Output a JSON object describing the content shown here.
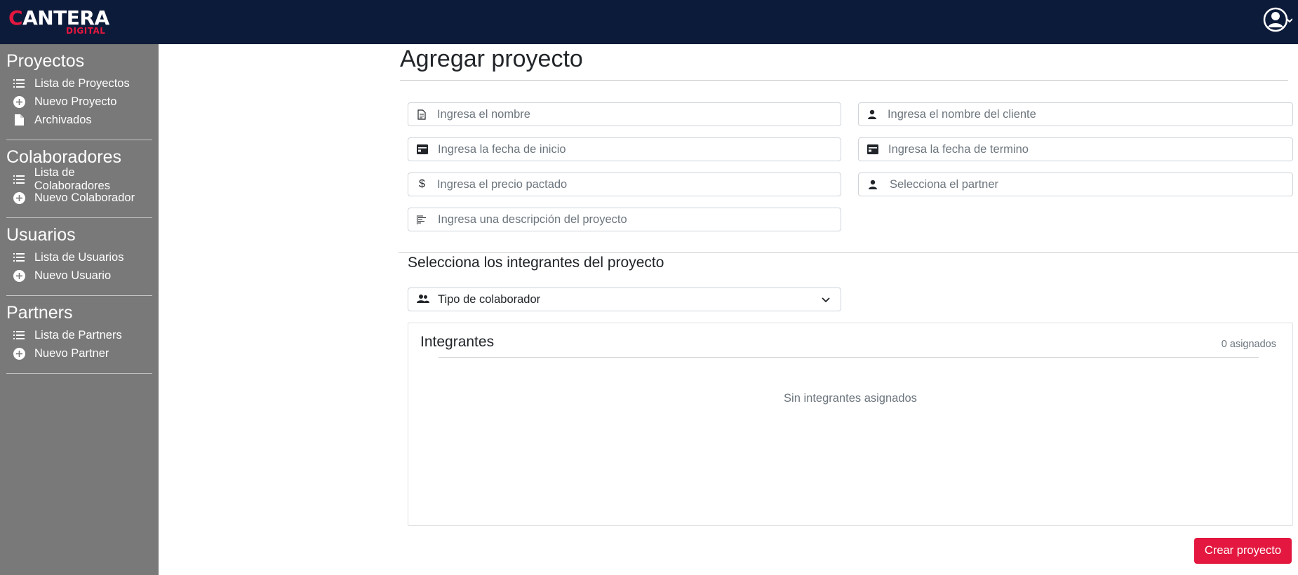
{
  "header": {
    "logo_main": "CANTERA",
    "logo_sub": "DIGITAL",
    "user_icon": "user-circle-icon"
  },
  "sidebar": {
    "sections": [
      {
        "title": "Proyectos",
        "items": [
          {
            "label": "Lista de Proyectos",
            "icon": "list-icon"
          },
          {
            "label": "Nuevo Proyecto",
            "icon": "plus-circle-icon"
          },
          {
            "label": "Archivados",
            "icon": "file-icon"
          }
        ]
      },
      {
        "title": "Colaboradores",
        "items": [
          {
            "label": "Lista de Colaboradores",
            "icon": "list-icon"
          },
          {
            "label": "Nuevo Colaborador",
            "icon": "plus-circle-icon"
          }
        ]
      },
      {
        "title": "Usuarios",
        "items": [
          {
            "label": "Lista de Usuarios",
            "icon": "list-icon"
          },
          {
            "label": "Nuevo Usuario",
            "icon": "plus-circle-icon"
          }
        ]
      },
      {
        "title": "Partners",
        "items": [
          {
            "label": "Lista de Partners",
            "icon": "list-icon"
          },
          {
            "label": "Nuevo Partner",
            "icon": "plus-circle-icon"
          }
        ]
      }
    ]
  },
  "main": {
    "title": "Agregar proyecto",
    "fields": {
      "name": {
        "placeholder": "Ingresa el nombre",
        "value": "",
        "icon": "document-icon"
      },
      "client": {
        "placeholder": "Ingresa el nombre del cliente",
        "value": "",
        "icon": "person-icon"
      },
      "start_date": {
        "placeholder": "Ingresa la fecha de inicio",
        "value": "",
        "icon": "calendar-card-icon"
      },
      "end_date": {
        "placeholder": "Ingresa la fecha de termino",
        "value": "",
        "icon": "calendar-card-icon"
      },
      "price": {
        "placeholder": "Ingresa el precio pactado",
        "value": "",
        "icon": "dollar-icon"
      },
      "partner": {
        "placeholder": "Selecciona el partner",
        "icon": "person-icon"
      },
      "description": {
        "placeholder": "Ingresa una descripción del proyecto",
        "value": "",
        "icon": "text-align-icon"
      }
    },
    "members_title": "Selecciona los integrantes del proyecto",
    "collaborator_type": {
      "label": "Tipo de colaborador",
      "icon": "people-icon"
    },
    "panel": {
      "title": "Integrantes",
      "count": "0 asignados",
      "empty": "Sin integrantes asignados"
    },
    "create_button": "Crear proyecto"
  },
  "colors": {
    "topbar": "#0d1b3a",
    "sidebar": "#797979",
    "accent": "#e3173f"
  }
}
